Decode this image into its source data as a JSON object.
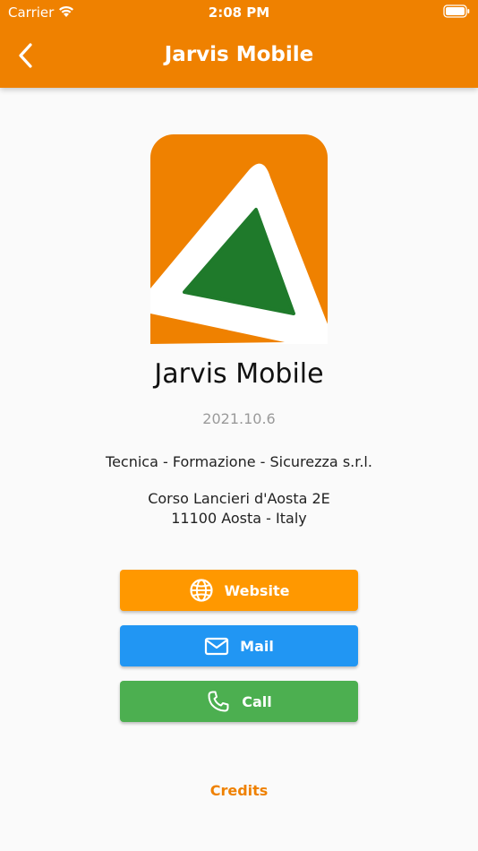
{
  "status_bar": {
    "carrier": "Carrier",
    "time": "2:08 PM"
  },
  "app_bar": {
    "title": "Jarvis Mobile",
    "back_icon": "chevron-left-icon"
  },
  "about": {
    "app_name": "Jarvis Mobile",
    "version": "2021.10.6",
    "company": "Tecnica - Formazione - Sicurezza s.r.l.",
    "address_line1": "Corso Lancieri d'Aosta 2E",
    "address_line2": "11100 Aosta - Italy"
  },
  "buttons": {
    "website": {
      "label": "Website",
      "icon": "globe-icon",
      "color": "#ff9800"
    },
    "mail": {
      "label": "Mail",
      "icon": "mail-icon",
      "color": "#2196f3"
    },
    "call": {
      "label": "Call",
      "icon": "phone-icon",
      "color": "#4caf50"
    }
  },
  "credits_label": "Credits",
  "colors": {
    "brand_orange": "#ef8100",
    "logo_green": "#1f7a2b",
    "background": "#fafafa"
  }
}
